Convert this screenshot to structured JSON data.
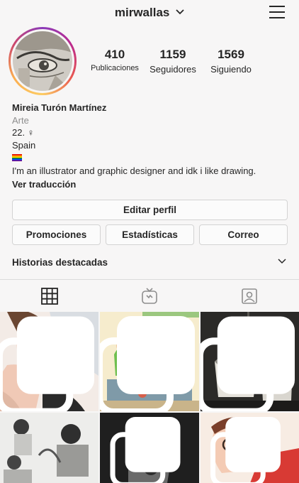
{
  "header": {
    "username": "mirwallas"
  },
  "stats": [
    {
      "value": "410",
      "label": "Publicaciones"
    },
    {
      "value": "1159",
      "label": "Seguidores"
    },
    {
      "value": "1569",
      "label": "Siguiendo"
    }
  ],
  "bio": {
    "name": "Mireia Turón Martínez",
    "category": "Arte",
    "line1": "22. ♀",
    "line2": "Spain",
    "flag": "rainbow-flag",
    "text": "I'm an illustrator and graphic designer and idk i like drawing.",
    "translate": "Ver traducción"
  },
  "buttons": {
    "edit": "Editar perfil",
    "promotions": "Promociones",
    "stats": "Estadísticas",
    "email": "Correo"
  },
  "highlights": {
    "label": "Historias destacadas"
  },
  "tabs": [
    "grid-icon",
    "igtv-icon",
    "tagged-icon"
  ],
  "colors": {
    "text": "#262626",
    "secondary": "#8e8e8e",
    "border": "#dbdbdb",
    "background": "#f7f6f6"
  }
}
